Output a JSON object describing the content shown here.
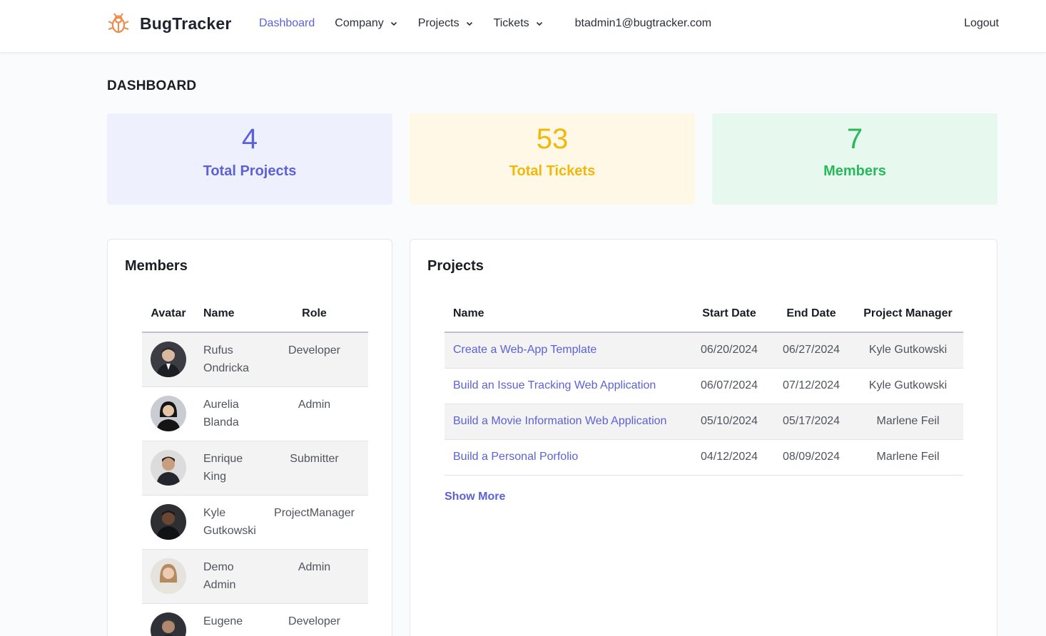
{
  "app": {
    "brand": "BugTracker",
    "logo_icon": "bug-icon"
  },
  "nav": {
    "dashboard": "Dashboard",
    "company": "Company",
    "projects": "Projects",
    "tickets": "Tickets",
    "user_email": "btadmin1@bugtracker.com",
    "logout": "Logout"
  },
  "colors": {
    "accent": "#5c62d6",
    "tickets": "#f0b80b",
    "members": "#29b85a"
  },
  "page": {
    "title": "DASHBOARD"
  },
  "stats": {
    "projects": {
      "value": "4",
      "label": "Total Projects"
    },
    "tickets": {
      "value": "53",
      "label": "Total Tickets"
    },
    "members": {
      "value": "7",
      "label": "Members"
    }
  },
  "members": {
    "title": "Members",
    "columns": [
      "Avatar",
      "Name",
      "Role"
    ],
    "rows": [
      {
        "first": "Rufus",
        "last": "Ondricka",
        "role": "Developer"
      },
      {
        "first": "Aurelia",
        "last": "Blanda",
        "role": "Admin"
      },
      {
        "first": "Enrique",
        "last": "King",
        "role": "Submitter"
      },
      {
        "first": "Kyle",
        "last": "Gutkowski",
        "role": "ProjectManager"
      },
      {
        "first": "Demo",
        "last": "Admin",
        "role": "Admin"
      },
      {
        "first": "Eugene",
        "last": "",
        "role": "Developer"
      }
    ]
  },
  "projects": {
    "title": "Projects",
    "columns": [
      "Name",
      "Start Date",
      "End Date",
      "Project Manager"
    ],
    "rows": [
      {
        "name": "Create a Web-App Template",
        "start": "06/20/2024",
        "end": "06/27/2024",
        "manager": "Kyle Gutkowski"
      },
      {
        "name": "Build an Issue Tracking Web Application",
        "start": "06/07/2024",
        "end": "07/12/2024",
        "manager": "Kyle Gutkowski"
      },
      {
        "name": "Build a Movie Information Web Application",
        "start": "05/10/2024",
        "end": "05/17/2024",
        "manager": "Marlene Feil"
      },
      {
        "name": "Build a Personal Porfolio",
        "start": "04/12/2024",
        "end": "08/09/2024",
        "manager": "Marlene Feil"
      }
    ],
    "show_more": "Show More"
  }
}
